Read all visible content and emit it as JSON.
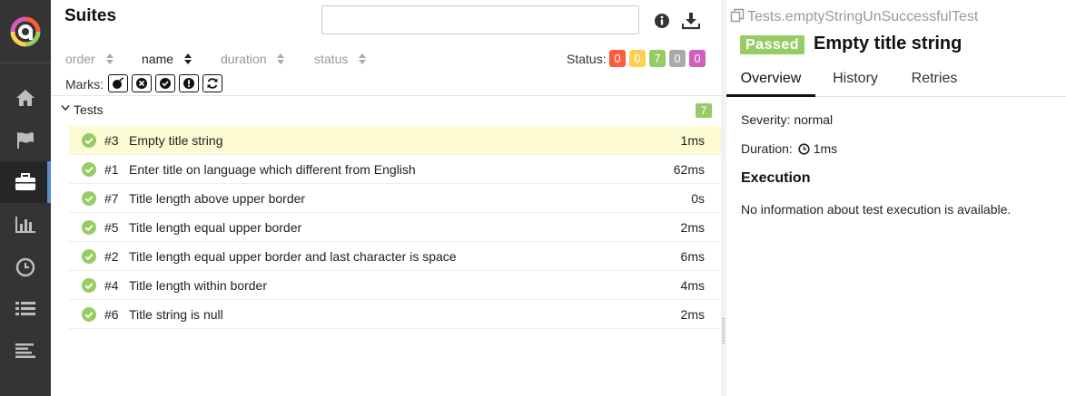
{
  "sidebar": {
    "items": [
      {
        "icon": "home-icon"
      },
      {
        "icon": "flag-icon"
      },
      {
        "icon": "briefcase-icon",
        "active": true
      },
      {
        "icon": "bar-chart-icon"
      },
      {
        "icon": "clock-icon"
      },
      {
        "icon": "list-icon"
      },
      {
        "icon": "timeline-icon"
      }
    ],
    "accent": "#5c8ccc",
    "background": "#343434"
  },
  "suites": {
    "title": "Suites",
    "search": {
      "value": "",
      "placeholder": ""
    },
    "sorters": [
      "order",
      "name",
      "duration",
      "status"
    ],
    "active_sorter": "name",
    "status_label": "Status:",
    "status_counters": [
      {
        "value": "0",
        "status": "failed",
        "color": "#fd5a3e"
      },
      {
        "value": "0",
        "status": "broken",
        "color": "#ffd050"
      },
      {
        "value": "7",
        "status": "passed",
        "color": "#97cc64"
      },
      {
        "value": "0",
        "status": "skipped",
        "color": "#aaaaaa"
      },
      {
        "value": "0",
        "status": "unknown",
        "color": "#d35ebe"
      }
    ],
    "marks_label": "Marks:",
    "marks": [
      "flaky-icon",
      "new-failed-icon",
      "new-passed-icon",
      "new-broken-icon",
      "retries-icon"
    ],
    "group": {
      "name": "Tests",
      "count": "7"
    },
    "tests": [
      {
        "num": "#3",
        "title": "Empty title string",
        "duration": "1ms",
        "selected": true
      },
      {
        "num": "#1",
        "title": "Enter title on language which different from English",
        "duration": "62ms"
      },
      {
        "num": "#7",
        "title": "Title length above upper border",
        "duration": "0s"
      },
      {
        "num": "#5",
        "title": "Title length equal upper border",
        "duration": "2ms"
      },
      {
        "num": "#2",
        "title": "Title length equal upper border and last character is space",
        "duration": "6ms"
      },
      {
        "num": "#4",
        "title": "Title length within border",
        "duration": "4ms"
      },
      {
        "num": "#6",
        "title": "Title string is null",
        "duration": "2ms"
      }
    ]
  },
  "detail": {
    "path": "Tests.emptyStringUnSuccessfulTest",
    "status_badge": "Passed",
    "title": "Empty title string",
    "tabs": [
      "Overview",
      "History",
      "Retries"
    ],
    "active_tab": "Overview",
    "severity": "Severity: normal",
    "duration_label": "Duration:",
    "duration_value": "1ms",
    "execution_title": "Execution",
    "execution_text": "No information about test execution is available."
  }
}
